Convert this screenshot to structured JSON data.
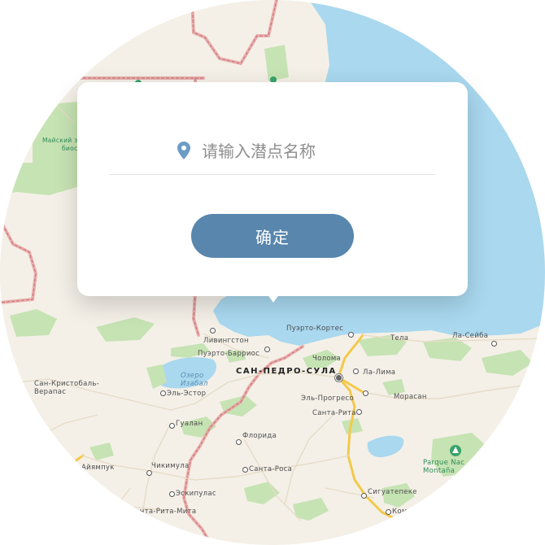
{
  "map": {
    "labels": {
      "biosphere": "Майский заповедник",
      "biosphere2": "биосф.",
      "livingston": "Ливингстон",
      "puerto_barrios": "Пуэрто-Барриос",
      "puerto_cortes": "Пуэрто-Кортес",
      "tela": "Тела",
      "la_ceiba": "Ла-Сейба",
      "san_pedro_sula": "САН-ПЕДРО-СУЛА",
      "choloma": "Чолома",
      "la_lima": "Ла-Лима",
      "lake_izabal_1": "Озеро",
      "lake_izabal_2": "Изабал",
      "el_estor": "Эль-Эстор",
      "san_cristobal_1": "Сан-Кристобаль-",
      "san_cristobal_2": "Верапас",
      "el_progreso": "Эль-Прогресо",
      "morasan": "Морасан",
      "santa_rita": "Санта-Рита",
      "gualan": "Гуалан",
      "florida": "Флорида",
      "ayampuk": "Айямпук",
      "chikimula": "Чикимула",
      "santa_rosa": "Санта-Роса",
      "eskipulas": "Эскипулас",
      "santa_rita_copan": "Санта-Рита-Мита",
      "siguatepeque": "Сигуатепеке",
      "kom": "Ком",
      "parque_1": "Parque Nac",
      "parque_2": "Montaña"
    }
  },
  "dialog": {
    "input_placeholder": "请输入潜点名称",
    "input_value": "",
    "confirm_label": "确定"
  },
  "icons": {
    "pin": "map-pin-icon",
    "park": "tree-icon"
  },
  "colors": {
    "water": "#a9d8ef",
    "land": "#f4f0e8",
    "park": "#c6e3b3",
    "border": "#e8a2a2",
    "road": "#f3c94a",
    "button": "#5886ad",
    "pin": "#6d9cc4"
  }
}
